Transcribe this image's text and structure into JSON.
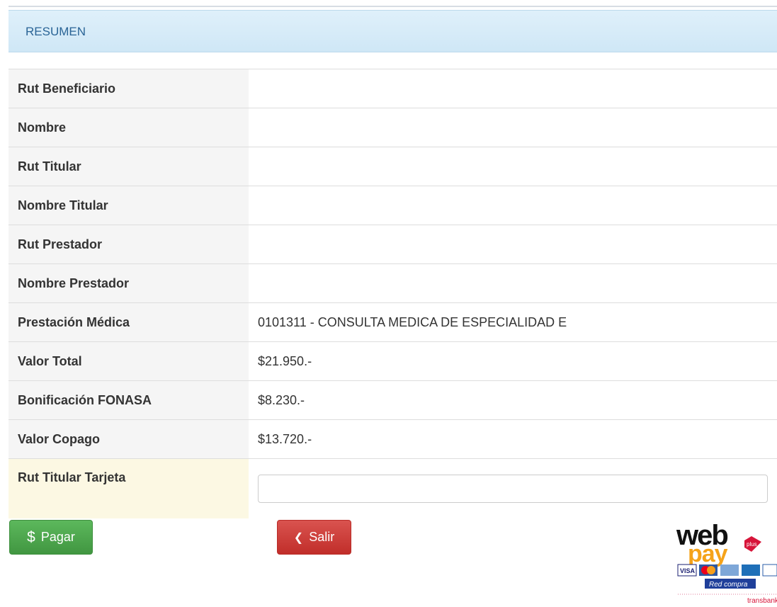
{
  "panel": {
    "title": "RESUMEN"
  },
  "rows": [
    {
      "label": "Rut Beneficiario",
      "value": ""
    },
    {
      "label": "Nombre",
      "value": ""
    },
    {
      "label": "Rut Titular",
      "value": ""
    },
    {
      "label": "Nombre Titular",
      "value": ""
    },
    {
      "label": "Rut Prestador",
      "value": ""
    },
    {
      "label": "Nombre Prestador",
      "value": ""
    },
    {
      "label": "Prestación Médica",
      "value": "0101311 - CONSULTA MEDICA DE ESPECIALIDAD E"
    },
    {
      "label": "Valor Total",
      "value": "$21.950.-"
    },
    {
      "label": "Bonificación FONASA",
      "value": "$8.230.-"
    },
    {
      "label": "Valor Copago",
      "value": "$13.720.-"
    }
  ],
  "card_holder": {
    "label": "Rut Titular Tarjeta",
    "value": "",
    "placeholder": ""
  },
  "buttons": {
    "pay": {
      "icon": "dollar-icon",
      "label": "Pagar"
    },
    "exit": {
      "icon": "chevron-left-icon",
      "label": "Salir"
    }
  },
  "logo": {
    "word1": "web",
    "word2": "pay",
    "badge": "plus",
    "cards": [
      "VISA",
      "",
      "",
      "",
      ""
    ],
    "redcompra": "Red compra",
    "brand": "transbank"
  },
  "colors": {
    "header_bg": "#d9edf7",
    "pay": "#5cb85c",
    "exit": "#d9534f",
    "warning_bg": "#fcf8e3"
  }
}
